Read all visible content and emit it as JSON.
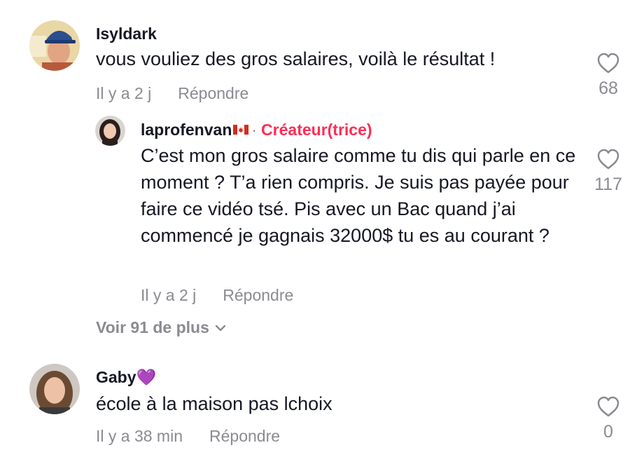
{
  "comments": [
    {
      "username": "Isyldark",
      "text": "vous vouliez des gros salaires, voilà le résultat !",
      "time": "Il y a 2 j",
      "reply_label": "Répondre",
      "likes": "68",
      "avatar_cap_text": "...",
      "avatar_sign_text": "..."
    },
    {
      "username": "laprofenvan",
      "separator": "·",
      "badge": "Créateur(trice)",
      "text": "C’est mon gros salaire comme tu dis qui parle en ce moment ? T’a rien compris. Je suis pas payée pour faire ce vidéo tsé. Pis avec un Bac quand j’ai commencé je gagnais 32000$ tu es au courant ?",
      "time": "Il y a 2 j",
      "reply_label": "Répondre",
      "likes": "117"
    },
    {
      "username": "Gaby💜",
      "text": "école à la maison pas lchoix",
      "time": "Il y a 38 min",
      "reply_label": "Répondre",
      "likes": "0"
    }
  ],
  "view_more": {
    "label": "Voir 91 de plus"
  },
  "colors": {
    "text": "#161823",
    "muted": "#8a8b91",
    "creator_badge": "#fe2c55"
  },
  "icons": [
    "heart-outline-icon",
    "chevron-down-icon",
    "canada-flag-icon"
  ]
}
